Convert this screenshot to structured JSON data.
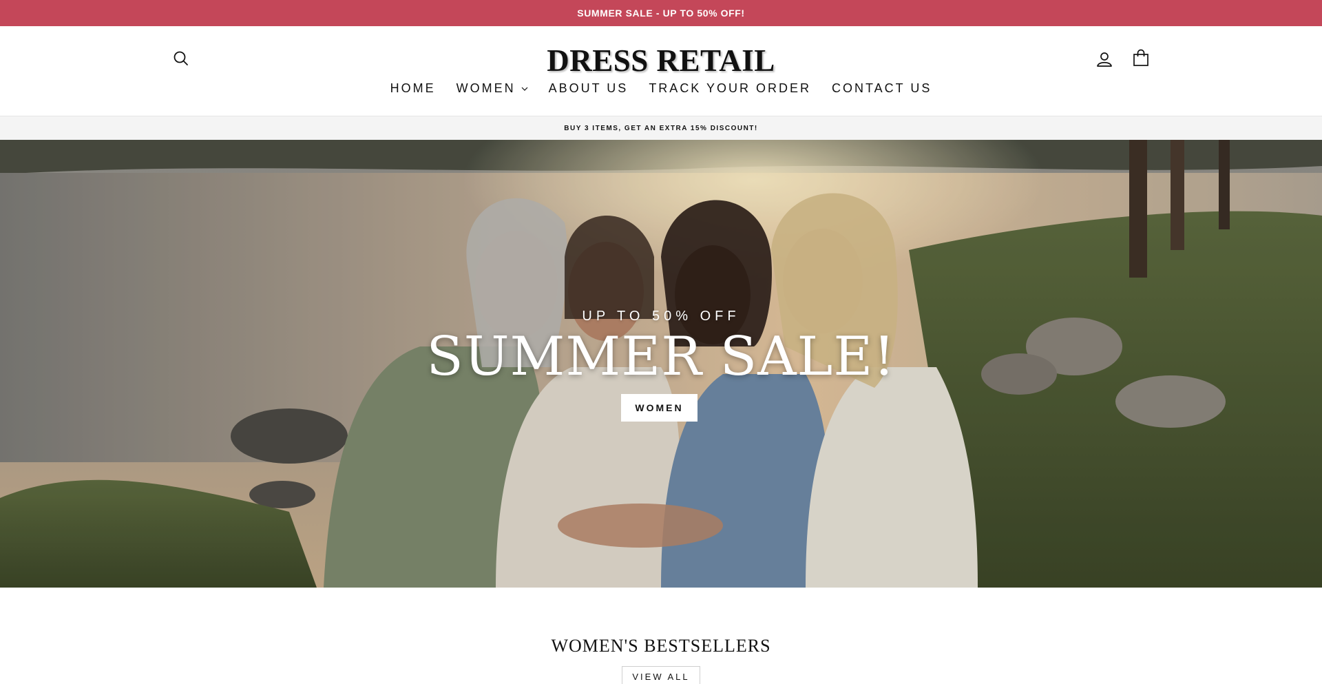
{
  "announcement": {
    "text": "SUMMER SALE - UP TO 50% OFF!"
  },
  "header": {
    "logo": "DRESS RETAIL",
    "icons": {
      "search": "search-icon",
      "account": "user-icon",
      "cart": "bag-icon"
    }
  },
  "nav": {
    "items": [
      {
        "label": "HOME"
      },
      {
        "label": "WOMEN",
        "has_dropdown": true
      },
      {
        "label": "ABOUT US"
      },
      {
        "label": "TRACK YOUR ORDER"
      },
      {
        "label": "CONTACT US"
      }
    ]
  },
  "promo": {
    "text": "BUY 3 ITEMS, GET AN EXTRA 15% DISCOUNT!"
  },
  "hero": {
    "subtitle": "UP TO 50% OFF",
    "title": "SUMMER SALE!",
    "button_label": "WOMEN",
    "image": "four-smiling-women-by-lake-at-sunset"
  },
  "bestsellers": {
    "title": "WOMEN'S BESTSELLERS",
    "view_all_label": "VIEW ALL"
  },
  "colors": {
    "announcement_bg": "#c44759",
    "promo_bg": "#f4f4f4",
    "text": "#111111",
    "white": "#ffffff"
  }
}
